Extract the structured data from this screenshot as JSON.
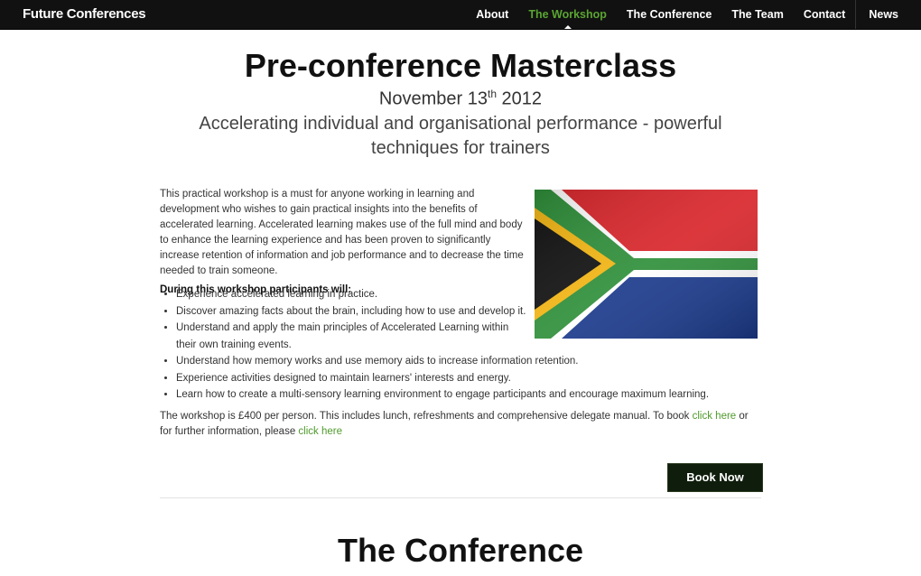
{
  "brand": "Future Conferences",
  "nav": {
    "about": "About",
    "workshop": "The Workshop",
    "conference": "The Conference",
    "team": "The Team",
    "contact": "Contact",
    "news": "News"
  },
  "hero": {
    "title": "Pre-conference Masterclass",
    "date_main": "November 13",
    "date_suffix": "th",
    "date_year": " 2012",
    "subtitle": "Accelerating individual and organisational performance - powerful techniques for trainers"
  },
  "intro": "This practical workshop is a must for anyone working in learning and development who wishes to gain practical insights into the benefits of accelerated learning. Accelerated learning makes use of the full mind and body to enhance the learning experience and has been proven to significantly increase retention of information and job performance and to decrease the time needed to train someone.",
  "list_heading": "During this workshop participants will:",
  "list_items": [
    "Experience accelerated learning in practice.",
    "Discover amazing facts about the brain, including how to use and develop it.",
    "Understand and apply the main principles of Accelerated Learning within their own training events.",
    "Understand how memory works and use memory aids to increase information retention.",
    "Experience activities designed to maintain learners' interests and energy.",
    "Learn how to create a multi-sensory learning environment to engage participants and encourage maximum learning."
  ],
  "price": {
    "text1": "The workshop is £400 per person. This includes lunch, refreshments and comprehensive delegate manual. To book ",
    "link1": "click here",
    "text2": " or for further information, please ",
    "link2": "click here"
  },
  "book_button": "Book Now",
  "next_section_title": "The Conference",
  "colors": {
    "accent": "#5aa531",
    "nav_bg": "#111111",
    "button_bg": "#0f1e0c"
  }
}
